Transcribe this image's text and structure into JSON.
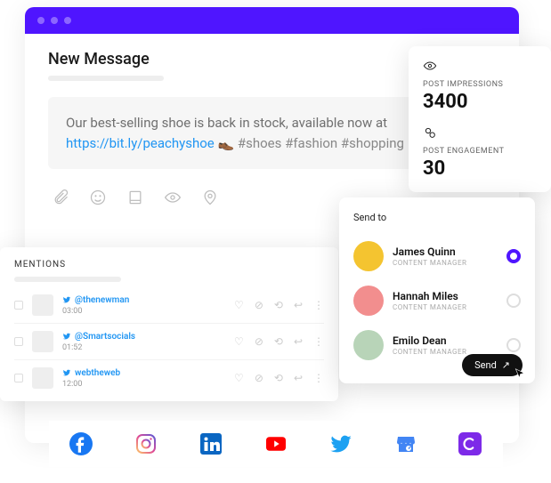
{
  "compose": {
    "title": "New Message",
    "body_text": "Our best-selling shoe is back in stock, available now at ",
    "body_link": "https://bit.ly/peachyshoe",
    "body_emoji": "👞",
    "body_tags": " #shoes #fashion #shopping"
  },
  "stats": {
    "impressions_label": "POST IMPRESSIONS",
    "impressions_value": "3400",
    "engagement_label": "POST ENGAGEMENT",
    "engagement_value": "30"
  },
  "mentions": {
    "title": "MENTIONS",
    "items": [
      {
        "handle": "@thenewman",
        "time": "03:00"
      },
      {
        "handle": "@Smartsocials",
        "time": "01:52"
      },
      {
        "handle": "webtheweb",
        "time": "12:00"
      }
    ]
  },
  "sendto": {
    "title": "Send to",
    "people": [
      {
        "name": "James Quinn",
        "role": "CONTENT MANAGER",
        "selected": true,
        "color": "#f4c430"
      },
      {
        "name": "Hannah Miles",
        "role": "CONTENT MANAGER",
        "selected": false,
        "color": "#f28e8e"
      },
      {
        "name": "Emilo Dean",
        "role": "CONTENT MANAGER",
        "selected": false,
        "color": "#b8d4b8"
      }
    ],
    "button": "Send"
  },
  "socials": [
    "facebook",
    "instagram",
    "linkedin",
    "youtube",
    "twitter",
    "google-business",
    "canva"
  ]
}
